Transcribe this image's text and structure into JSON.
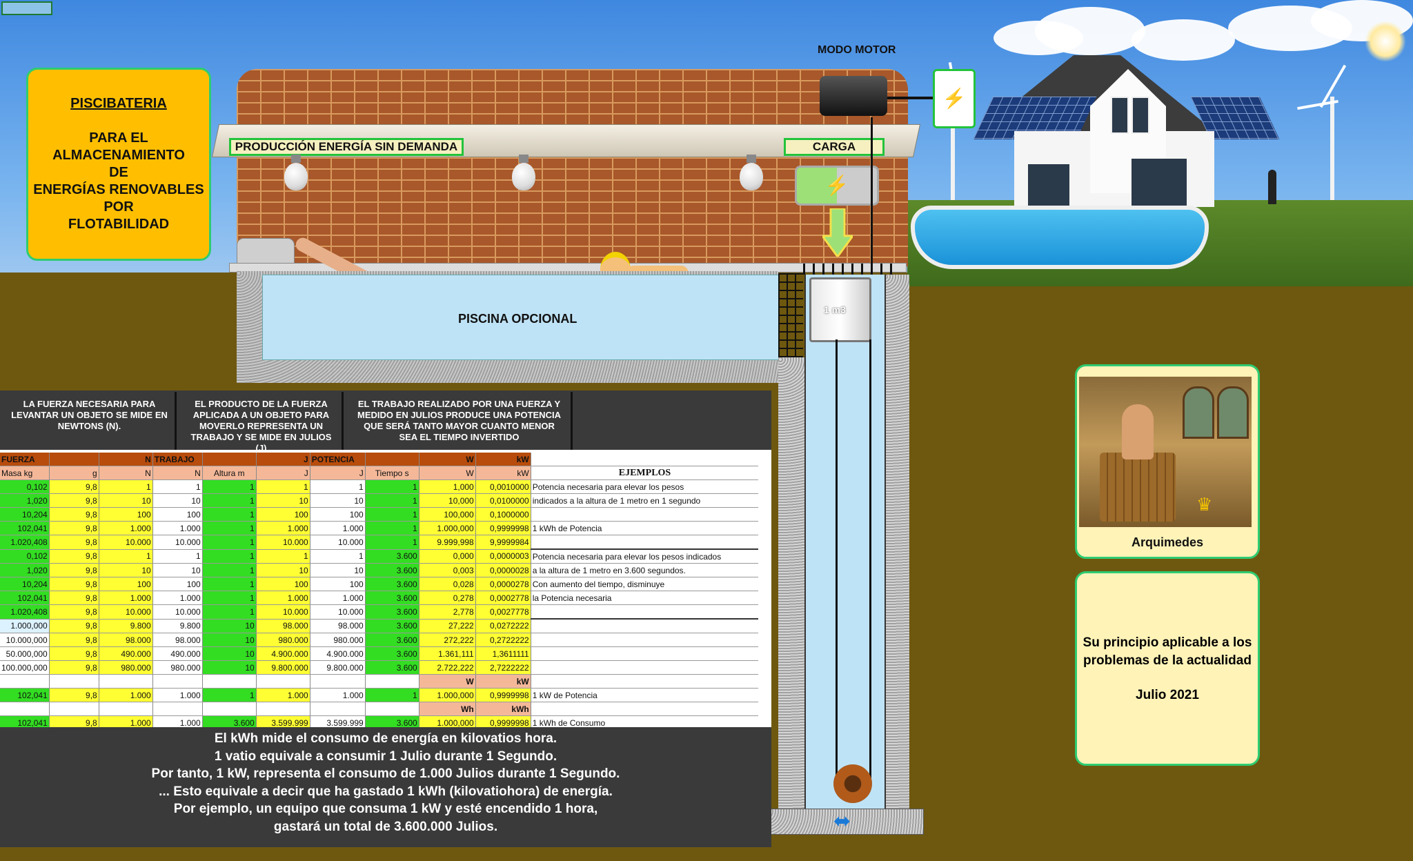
{
  "scene": {
    "mode_label": "MODO MOTOR",
    "production_label": "PRODUCCIÓN ENERGÍA SIN DEMANDA",
    "charge_label": "CARGA",
    "pool_label": "PISCINA OPCIONAL",
    "tank_label": "1 m3"
  },
  "title_box": {
    "line1": "PISCIBATERIA",
    "line2": "PARA EL",
    "line3": "ALMACENAMIENTO",
    "line4": "DE",
    "line5": "ENERGÍAS RENOVABLES",
    "line6": "POR",
    "line7": "FLOTABILIDAD"
  },
  "explanations": {
    "fuerza": "LA FUERZA NECESARIA  PARA LEVANTAR UN OBJETO SE MIDE EN NEWTONS (N).",
    "trabajo": "EL PRODUCTO DE LA FUERZA APLICADA A UN OBJETO PARA MOVERLO REPRESENTA UN TRABAJO Y SE MIDE EN JULIOS (J)",
    "potencia": "EL TRABAJO REALIZADO POR UNA FUERZA Y MEDIDO EN JULIOS PRODUCE UNA POTENCIA QUE SERÁ TANTO MAYOR CUANTO MENOR SEA EL TIEMPO INVERTIDO"
  },
  "table": {
    "header1": [
      "FUERZA",
      "",
      "N",
      "TRABAJO",
      "",
      "J",
      "POTENCIA",
      "",
      "W",
      "kW"
    ],
    "header2": [
      "Masa kg",
      "g",
      "N",
      "N",
      "Altura  m",
      "J",
      "J",
      "Tiempo s",
      "W",
      "kW"
    ],
    "examples_title": "EJEMPLOS",
    "rows": [
      [
        "0,102",
        "9,8",
        "1",
        "1",
        "1",
        "1",
        "1",
        "1",
        "1,000",
        "0,0010000"
      ],
      [
        "1,020",
        "9,8",
        "10",
        "10",
        "1",
        "10",
        "10",
        "1",
        "10,000",
        "0,0100000"
      ],
      [
        "10,204",
        "9,8",
        "100",
        "100",
        "1",
        "100",
        "100",
        "1",
        "100,000",
        "0,1000000"
      ],
      [
        "102,041",
        "9,8",
        "1.000",
        "1.000",
        "1",
        "1.000",
        "1.000",
        "1",
        "1.000,000",
        "0,9999998"
      ],
      [
        "1.020,408",
        "9,8",
        "10.000",
        "10.000",
        "1",
        "10.000",
        "10.000",
        "1",
        "9.999,998",
        "9,9999984"
      ],
      [
        "0,102",
        "9,8",
        "1",
        "1",
        "1",
        "1",
        "1",
        "3.600",
        "0,000",
        "0,0000003"
      ],
      [
        "1,020",
        "9,8",
        "10",
        "10",
        "1",
        "10",
        "10",
        "3.600",
        "0,003",
        "0,0000028"
      ],
      [
        "10,204",
        "9,8",
        "100",
        "100",
        "1",
        "100",
        "100",
        "3.600",
        "0,028",
        "0,0000278"
      ],
      [
        "102,041",
        "9,8",
        "1.000",
        "1.000",
        "1",
        "1.000",
        "1.000",
        "3.600",
        "0,278",
        "0,0002778"
      ],
      [
        "1.020,408",
        "9,8",
        "10.000",
        "10.000",
        "1",
        "10.000",
        "10.000",
        "3.600",
        "2,778",
        "0,0027778"
      ],
      [
        "1.000,000",
        "9,8",
        "9.800",
        "9.800",
        "10",
        "98.000",
        "98.000",
        "3.600",
        "27,222",
        "0,0272222"
      ],
      [
        "10.000,000",
        "9,8",
        "98.000",
        "98.000",
        "10",
        "980.000",
        "980.000",
        "3.600",
        "272,222",
        "0,2722222"
      ],
      [
        "50.000,000",
        "9,8",
        "490.000",
        "490.000",
        "10",
        "4.900.000",
        "4.900.000",
        "3.600",
        "1.361,111",
        "1,3611111"
      ],
      [
        "100.000,000",
        "9,8",
        "980.000",
        "980.000",
        "10",
        "9.800.000",
        "9.800.000",
        "3.600",
        "2.722,222",
        "2,7222222"
      ]
    ],
    "sub_w": [
      "W",
      "kW"
    ],
    "row_power": [
      "102,041",
      "9,8",
      "1.000",
      "1.000",
      "1",
      "1.000",
      "1.000",
      "1",
      "1.000,000",
      "0,9999998"
    ],
    "sub_wh": [
      "Wh",
      "kWh"
    ],
    "row_consumo": [
      "102,041",
      "9,8",
      "1.000",
      "1.000",
      "3.600",
      "3.599.999",
      "3.599.999",
      "3.600",
      "1.000,000",
      "0,9999998"
    ],
    "examples": {
      "e1a": "Potencia necesaria para elevar los pesos",
      "e1b": "indicados a la altura de 1 metro en 1 segundo",
      "e1c": "1 kWh de Potencia",
      "e2a": "Potencia necesaria para elevar los pesos indicados",
      "e2b": "a la altura de 1 metro en 3.600 segundos.",
      "e2c": "Con aumento del tiempo, disminuye",
      "e2d": " la Potencia necesaria",
      "e3": "1 kW de Potencia",
      "e4": "1 kWh de Consumo"
    }
  },
  "bottom_note": {
    "l1": "El kWh mide el consumo de energía en kilovatios hora.",
    "l2": "1 vatio equivale a consumir 1 Julio durante 1 Segundo.",
    "l3": "Por tanto, 1 kW, representa el consumo de 1.000 Julios durante 1 Segundo.",
    "l4": "... Esto equivale a decir que ha gastado 1 kWh (kilovatiohora) de energía.",
    "l5": "Por ejemplo, un equipo que consuma 1 kW y esté encendido 1 hora,",
    "l6": "gastará un total de 3.600.000 Julios."
  },
  "archimedes": {
    "caption": "Arquimedes"
  },
  "quote": {
    "l1": "Su principio aplicable a los",
    "l2": "problemas de la actualidad",
    "l3": "Julio 2021"
  }
}
